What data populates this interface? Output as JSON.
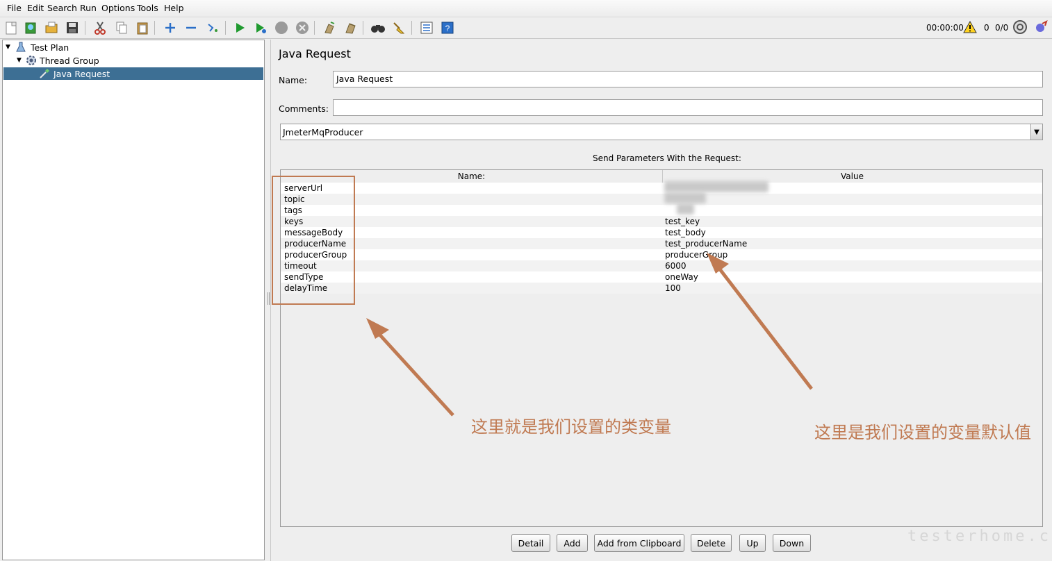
{
  "menu": [
    "File",
    "Edit",
    "Search",
    "Run",
    "Options",
    "Tools",
    "Help"
  ],
  "toolbar": {
    "timer": "00:00:00",
    "warning_count": "0",
    "thread_ratio": "0/0"
  },
  "tree": {
    "items": [
      {
        "label": "Test Plan",
        "icon": "flask-icon"
      },
      {
        "label": "Thread Group",
        "icon": "gear-icon"
      },
      {
        "label": "Java Request",
        "icon": "pipette-icon"
      }
    ]
  },
  "panel": {
    "title": "Java Request",
    "name_label": "Name:",
    "name_value": "Java Request",
    "comments_label": "Comments:",
    "comments_value": "",
    "classname_value": "JmeterMqProducer",
    "params_title": "Send Parameters With the Request:",
    "col_name": "Name:",
    "col_value": "Value"
  },
  "params": [
    {
      "name": "serverUrl",
      "value": ""
    },
    {
      "name": "topic",
      "value": ""
    },
    {
      "name": "tags",
      "value": ""
    },
    {
      "name": "keys",
      "value": "test_key"
    },
    {
      "name": "messageBody",
      "value": "test_body"
    },
    {
      "name": "producerName",
      "value": "test_producerName"
    },
    {
      "name": "producerGroup",
      "value": "producerGroup"
    },
    {
      "name": "timeout",
      "value": "6000"
    },
    {
      "name": "sendType",
      "value": "oneWay"
    },
    {
      "name": "delayTime",
      "value": "100"
    }
  ],
  "buttons": [
    "Detail",
    "Add",
    "Add from Clipboard",
    "Delete",
    "Up",
    "Down"
  ],
  "annotations": {
    "left": "这里就是我们设置的类变量",
    "right": "这里是我们设置的变量默认值",
    "color": "#c07a52"
  },
  "watermark": "testerhome.com"
}
